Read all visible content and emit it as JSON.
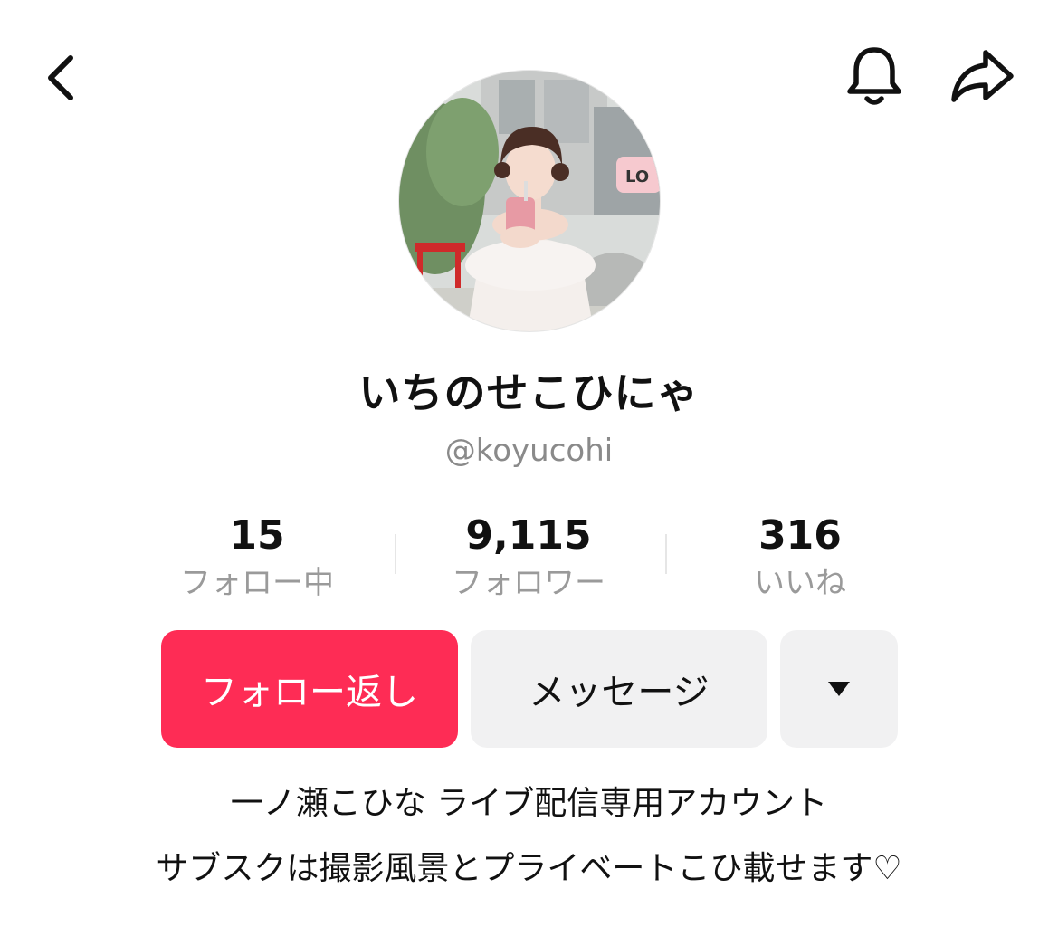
{
  "header": {
    "back_icon": "chevron-left-icon",
    "bell_icon": "bell-icon",
    "share_icon": "share-arrow-icon"
  },
  "profile": {
    "display_name": "いちのせこひにゃ",
    "handle": "@koyucohi"
  },
  "stats": [
    {
      "value": "15",
      "label": "フォロー中"
    },
    {
      "value": "9,115",
      "label": "フォロワー"
    },
    {
      "value": "316",
      "label": "いいね"
    }
  ],
  "actions": {
    "follow_back_label": "フォロー返し",
    "message_label": "メッセージ",
    "more_icon": "caret-down-icon"
  },
  "bio": [
    "一ノ瀬こひな ライブ配信専用アカウント",
    "サブスクは撮影風景とプライベートこひ載せます♡"
  ],
  "colors": {
    "accent": "#fe2c55",
    "secondary_button": "#f1f1f2",
    "muted_text": "#8a8a8a"
  }
}
